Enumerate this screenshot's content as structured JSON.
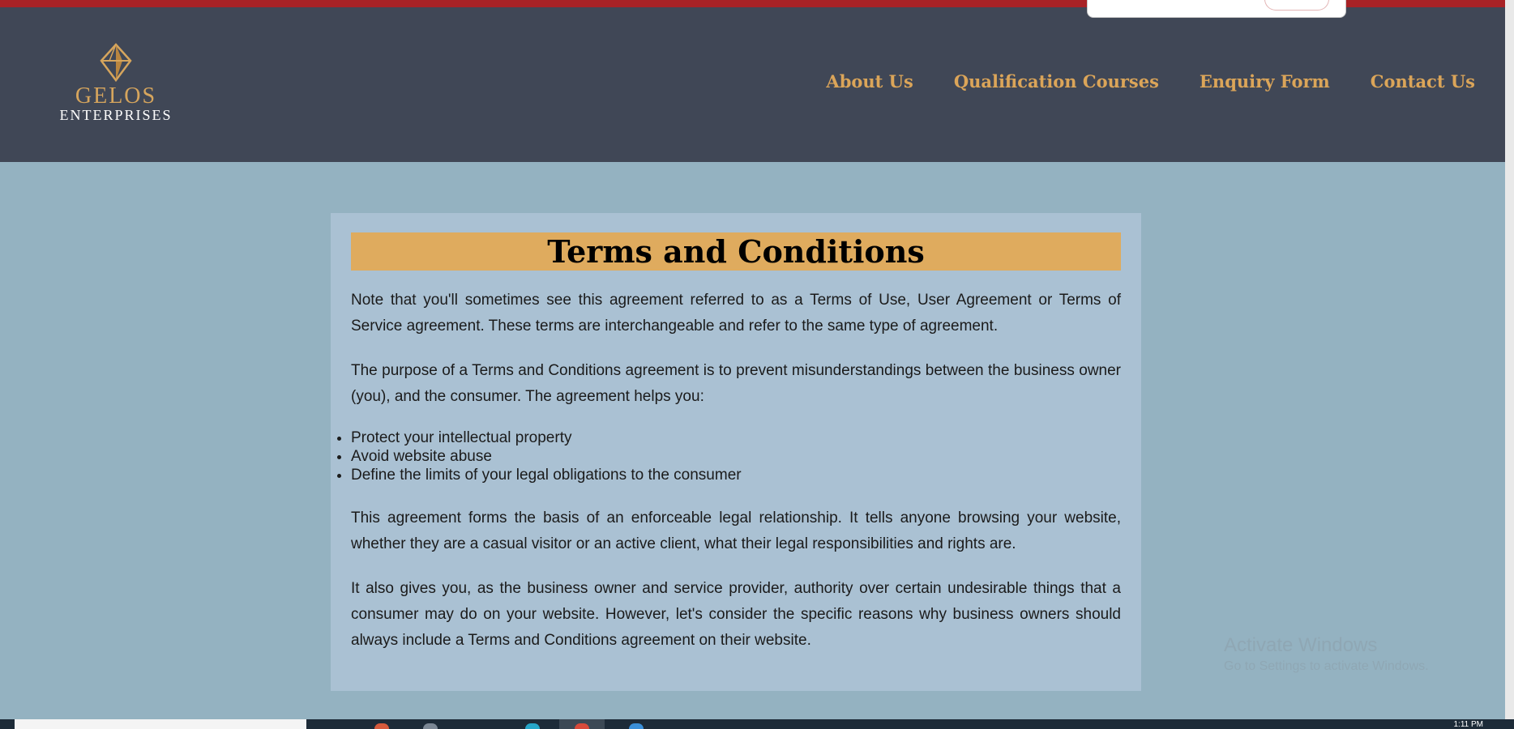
{
  "logo": {
    "name": "GELOS",
    "subtitle": "ENTERPRISES"
  },
  "nav": {
    "items": [
      {
        "label": "About Us"
      },
      {
        "label": "Qualification Courses"
      },
      {
        "label": "Enquiry Form"
      },
      {
        "label": "Contact Us"
      }
    ]
  },
  "content": {
    "title": "Terms and Conditions",
    "paragraph1": "Note that you'll sometimes see this agreement referred to as a Terms of Use, User Agreement or Terms of Service agreement. These terms are interchangeable and refer to the same type of agreement.",
    "paragraph2": "The purpose of a Terms and Conditions agreement is to prevent misunderstandings between the business owner (you), and the consumer. The agreement helps you:",
    "list": [
      "Protect your intellectual property",
      "Avoid website abuse",
      "Define the limits of your legal obligations to the consumer"
    ],
    "paragraph3": "This agreement forms the basis of an enforceable legal relationship. It tells anyone browsing your website, whether they are a casual visitor or an active client, what their legal responsibilities and rights are.",
    "paragraph4": "It also gives you, as the business owner and service provider, authority over certain undesirable things that a consumer may do on your website. However, let's consider the specific reasons why business owners should always include a Terms and Conditions agreement on their website."
  },
  "watermark": {
    "title": "Activate Windows",
    "subtitle": "Go to Settings to activate Windows."
  },
  "taskbar": {
    "clock": "1:11 PM"
  },
  "colors": {
    "top_stripe": "#a82226",
    "header_bg": "#404756",
    "nav_text": "#dba559",
    "page_bg": "#94b2c1",
    "card_bg": "#aac1d3",
    "title_bar": "#dfab5e"
  }
}
